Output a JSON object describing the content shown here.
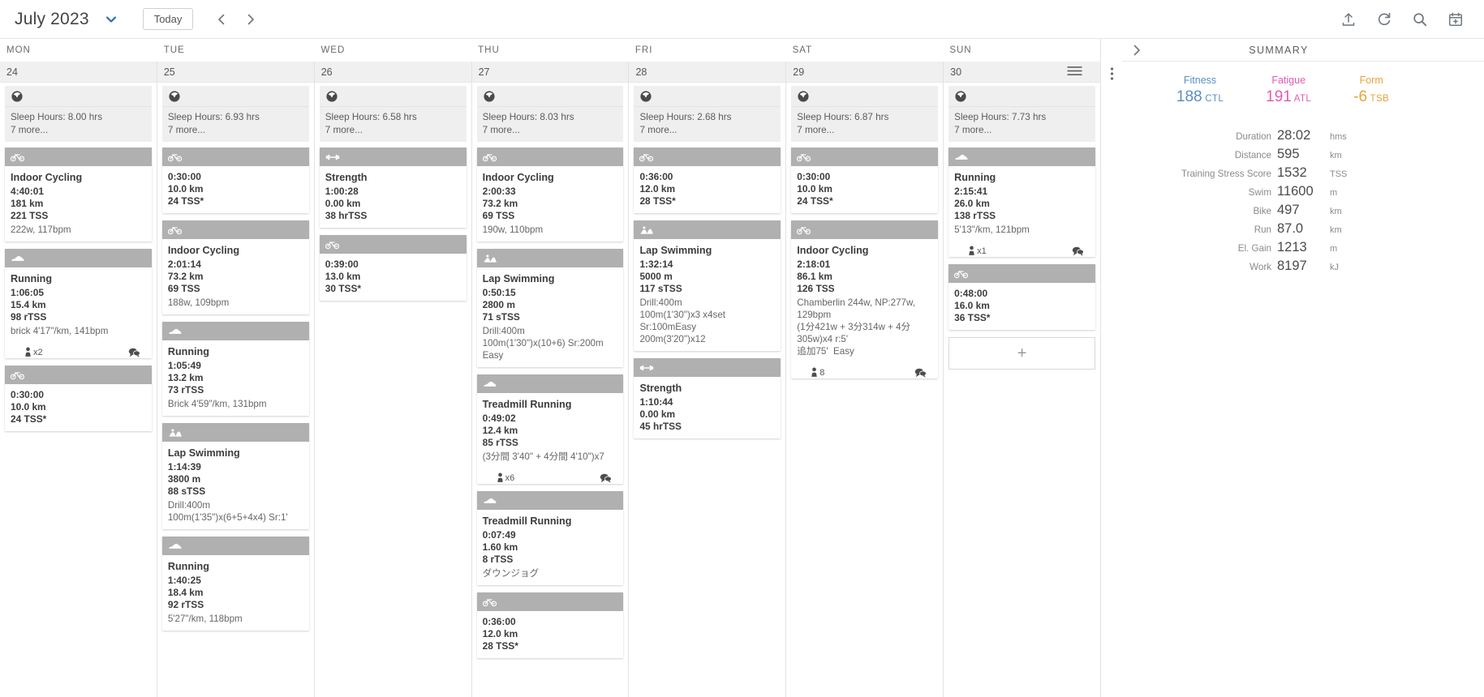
{
  "topbar": {
    "month_title": "July 2023",
    "today_label": "Today",
    "dropdown_icon": "chevron-down-icon",
    "prev_icon": "chevron-left-icon",
    "next_icon": "chevron-right-icon",
    "icons": [
      "upload-icon",
      "sync-icon",
      "search-icon",
      "calendar-add-icon"
    ]
  },
  "weekdays": [
    "MON",
    "TUE",
    "WED",
    "THU",
    "FRI",
    "SAT",
    "SUN"
  ],
  "days": [
    {
      "date": "24",
      "metrics": {
        "icon": "sleep-gauge-icon",
        "line1": "Sleep Hours: 8.00 hrs",
        "line2": "7 more..."
      },
      "workouts": [
        {
          "sport": "bike-icon",
          "title": "Indoor Cycling",
          "duration": "4:40:01",
          "distance": "181 km",
          "tss": "221 TSS",
          "desc": "222w, 117bpm",
          "attachments": "",
          "comment": false
        },
        {
          "sport": "run-icon",
          "title": "Running",
          "duration": "1:06:05",
          "distance": "15.4 km",
          "tss": "98 rTSS",
          "desc": "brick 4'17\"/km, 141bpm",
          "attachments": "x2",
          "comment": true
        },
        {
          "sport": "bike-icon",
          "title": "",
          "duration": "0:30:00",
          "distance": "10.0 km",
          "tss": "24 TSS*",
          "desc": "",
          "attachments": "",
          "comment": false
        }
      ],
      "add_box": false
    },
    {
      "date": "25",
      "metrics": {
        "icon": "sleep-gauge-icon",
        "line1": "Sleep Hours: 6.93 hrs",
        "line2": "7 more..."
      },
      "workouts": [
        {
          "sport": "bike-icon",
          "title": "",
          "duration": "0:30:00",
          "distance": "10.0 km",
          "tss": "24 TSS*",
          "desc": "",
          "attachments": "",
          "comment": false
        },
        {
          "sport": "bike-icon",
          "title": "Indoor Cycling",
          "duration": "2:01:14",
          "distance": "73.2 km",
          "tss": "69 TSS",
          "desc": "188w, 109bpm",
          "attachments": "",
          "comment": false
        },
        {
          "sport": "run-icon",
          "title": "Running",
          "duration": "1:05:49",
          "distance": "13.2 km",
          "tss": "73 rTSS",
          "desc": "Brick 4'59\"/km, 131bpm",
          "attachments": "",
          "comment": false
        },
        {
          "sport": "swim-icon",
          "title": "Lap Swimming",
          "duration": "1:14:39",
          "distance": "3800 m",
          "tss": "88 sTSS",
          "desc": "Drill:400m\n100m(1'35\")x(6+5+4x4) Sr:1'",
          "attachments": "",
          "comment": false
        },
        {
          "sport": "run-icon",
          "title": "Running",
          "duration": "1:40:25",
          "distance": "18.4 km",
          "tss": "92 rTSS",
          "desc": "5'27\"/km, 118bpm",
          "attachments": "",
          "comment": false
        }
      ],
      "add_box": false
    },
    {
      "date": "26",
      "metrics": {
        "icon": "sleep-gauge-icon",
        "line1": "Sleep Hours: 6.58 hrs",
        "line2": "7 more..."
      },
      "workouts": [
        {
          "sport": "strength-icon",
          "title": "Strength",
          "duration": "1:00:28",
          "distance": "0.00 km",
          "tss": "38 hrTSS",
          "desc": "",
          "attachments": "",
          "comment": false
        },
        {
          "sport": "bike-icon",
          "title": "",
          "duration": "0:39:00",
          "distance": "13.0 km",
          "tss": "30 TSS*",
          "desc": "",
          "attachments": "",
          "comment": false
        }
      ],
      "add_box": false
    },
    {
      "date": "27",
      "metrics": {
        "icon": "sleep-gauge-icon",
        "line1": "Sleep Hours: 8.03 hrs",
        "line2": "7 more..."
      },
      "workouts": [
        {
          "sport": "bike-icon",
          "title": "Indoor Cycling",
          "duration": "2:00:33",
          "distance": "73.2 km",
          "tss": "69 TSS",
          "desc": "190w, 110bpm",
          "attachments": "",
          "comment": false
        },
        {
          "sport": "swim-icon",
          "title": "Lap Swimming",
          "duration": "0:50:15",
          "distance": "2800 m",
          "tss": "71 sTSS",
          "desc": "Drill:400m\n100m(1'30\")x(10+6) Sr:200m Easy",
          "attachments": "",
          "comment": false
        },
        {
          "sport": "run-icon",
          "title": "Treadmill Running",
          "duration": "0:49:02",
          "distance": "12.4 km",
          "tss": "85 rTSS",
          "desc": "(3分間 3'40\" + 4分間 4'10\")x7",
          "attachments": "x6",
          "comment": true
        },
        {
          "sport": "run-icon",
          "title": "Treadmill Running",
          "duration": "0:07:49",
          "distance": "1.60 km",
          "tss": "8 rTSS",
          "desc": "ダウンジョグ",
          "attachments": "",
          "comment": false
        },
        {
          "sport": "bike-icon",
          "title": "",
          "duration": "0:36:00",
          "distance": "12.0 km",
          "tss": "28 TSS*",
          "desc": "",
          "attachments": "",
          "comment": false
        }
      ],
      "add_box": false
    },
    {
      "date": "28",
      "metrics": {
        "icon": "sleep-gauge-icon",
        "line1": "Sleep Hours: 2.68 hrs",
        "line2": "7 more..."
      },
      "workouts": [
        {
          "sport": "bike-icon",
          "title": "",
          "duration": "0:36:00",
          "distance": "12.0 km",
          "tss": "28 TSS*",
          "desc": "",
          "attachments": "",
          "comment": false
        },
        {
          "sport": "swim-icon",
          "title": "Lap Swimming",
          "duration": "1:32:14",
          "distance": "5000 m",
          "tss": "117 sTSS",
          "desc": "Drill:400m\n100m(1'30\")x3 x4set    Sr:100mEasy\n200m(3'20\")x12",
          "attachments": "",
          "comment": false
        },
        {
          "sport": "strength-icon",
          "title": "Strength",
          "duration": "1:10:44",
          "distance": "0.00 km",
          "tss": "45 hrTSS",
          "desc": "",
          "attachments": "",
          "comment": false
        }
      ],
      "add_box": false
    },
    {
      "date": "29",
      "metrics": {
        "icon": "sleep-gauge-icon",
        "line1": "Sleep Hours: 6.87 hrs",
        "line2": "7 more..."
      },
      "workouts": [
        {
          "sport": "bike-icon",
          "title": "",
          "duration": "0:30:00",
          "distance": "10.0 km",
          "tss": "24 TSS*",
          "desc": "",
          "attachments": "",
          "comment": false
        },
        {
          "sport": "bike-icon",
          "title": "Indoor Cycling",
          "duration": "2:18:01",
          "distance": "86.1 km",
          "tss": "126 TSS",
          "desc": "Chamberlin 244w, NP:277w, 129bpm\n(1分421w + 3分314w + 4分305w)x4 r:5'\n追加75'  Easy",
          "attachments": "8",
          "comment": true
        }
      ],
      "add_box": false
    },
    {
      "date": "30",
      "metrics": {
        "icon": "sleep-gauge-icon",
        "line1": "Sleep Hours: 7.73 hrs",
        "line2": "7 more..."
      },
      "workouts": [
        {
          "sport": "run-icon",
          "title": "Running",
          "duration": "2:15:41",
          "distance": "26.0 km",
          "tss": "138 rTSS",
          "desc": "5'13\"/km, 121bpm",
          "attachments": "x1",
          "comment": true
        },
        {
          "sport": "bike-icon",
          "title": "",
          "duration": "0:48:00",
          "distance": "16.0 km",
          "tss": "36 TSS*",
          "desc": "",
          "attachments": "",
          "comment": false
        }
      ],
      "add_box": true,
      "add_label": "+"
    }
  ],
  "summary": {
    "title": "SUMMARY",
    "expand_icon": "chevron-right-icon",
    "pmc": [
      {
        "label": "Fitness",
        "value": "188",
        "unit": "CTL",
        "color": "#5b8ec4"
      },
      {
        "label": "Fatigue",
        "value": "191",
        "unit": "ATL",
        "color": "#e05bb4"
      },
      {
        "label": "Form",
        "value": "-6",
        "unit": "TSB",
        "color": "#e8a33d"
      }
    ],
    "totals": [
      {
        "key": "Duration",
        "value": "28:02",
        "unit": "hms"
      },
      {
        "key": "Distance",
        "value": "595",
        "unit": "km"
      },
      {
        "key": "Training Stress Score",
        "value": "1532",
        "unit": "TSS"
      },
      {
        "key": "Swim",
        "value": "11600",
        "unit": "m"
      },
      {
        "key": "Bike",
        "value": "497",
        "unit": "km"
      },
      {
        "key": "Run",
        "value": "87.0",
        "unit": "km"
      },
      {
        "key": "El. Gain",
        "value": "1213",
        "unit": "m"
      },
      {
        "key": "Work",
        "value": "8197",
        "unit": "kJ"
      }
    ]
  }
}
